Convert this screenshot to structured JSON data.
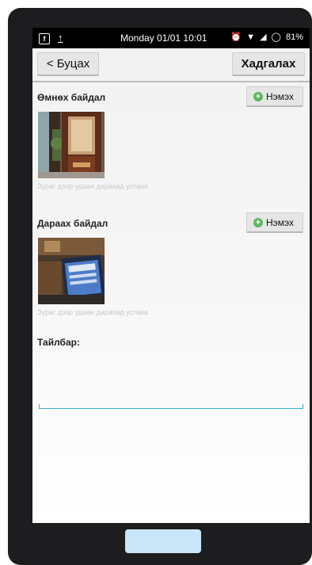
{
  "status_bar": {
    "time_text": "Monday 01/01 10:01",
    "battery": "81%"
  },
  "toolbar": {
    "back_label": "< Буцах",
    "save_label": "Хадгалах"
  },
  "before": {
    "title": "Өмнөх байдал",
    "add_label": "Нэмэх",
    "hint": "Зураг дээр удаан дарахад устана"
  },
  "after": {
    "title": "Дараах байдал",
    "add_label": "Нэмэх",
    "hint": "Зураг дээр удаан дарахад устана"
  },
  "note": {
    "label": "Тайлбар:",
    "value": ""
  },
  "colors": {
    "accent": "#39a9c8",
    "add_icon": "#5cb85c"
  }
}
